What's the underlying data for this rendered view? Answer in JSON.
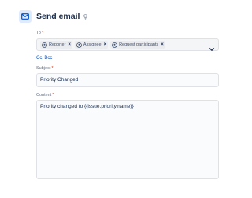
{
  "header": {
    "title": "Send email",
    "icon": "envelope-icon",
    "info_icon": "info-icon",
    "accent_color": "#0052cc",
    "icon_bg_color": "#deebff"
  },
  "to": {
    "label": "To",
    "required_mark": "*",
    "chips": [
      {
        "label": "Reporter",
        "icon": "user-icon"
      },
      {
        "label": "Assignee",
        "icon": "user-icon"
      },
      {
        "label": "Request participants",
        "icon": "user-icon"
      }
    ],
    "remove_glyph": "×",
    "dropdown_icon": "chevron-down-icon"
  },
  "cc_bcc": {
    "cc_label": "Cc",
    "bcc_label": "Bcc",
    "link_color": "#0052cc"
  },
  "subject": {
    "label": "Subject",
    "required_mark": "*",
    "value": "Priority Changed"
  },
  "content": {
    "label": "Content",
    "required_mark": "*",
    "value": "Priority changed to {{issue.priority.name}}"
  }
}
